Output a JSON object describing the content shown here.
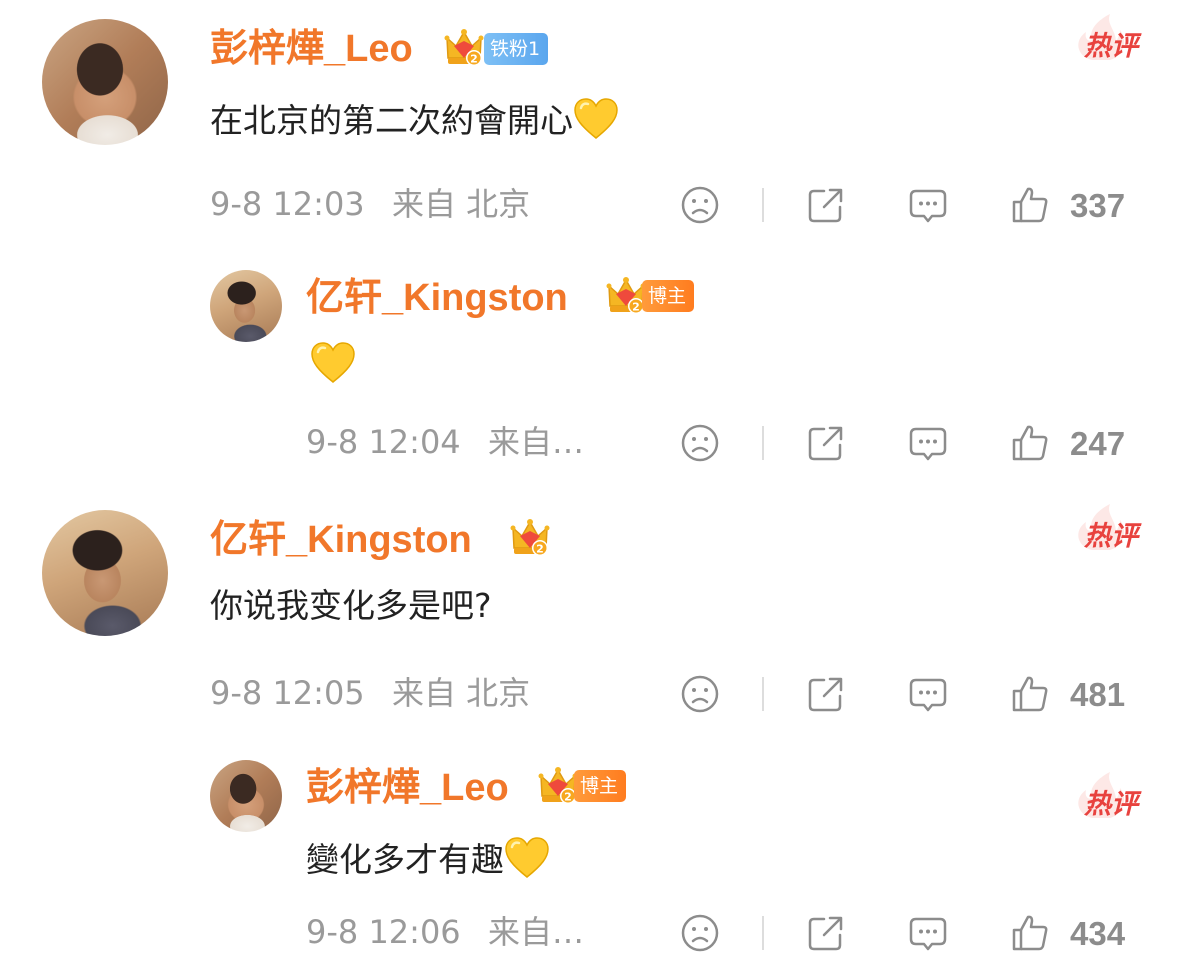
{
  "comments": [
    {
      "username": "彭梓燁_Leo",
      "badge": "铁粉1",
      "text": "在北京的第二次約會開心",
      "time": "9-8 12:03",
      "location": "来自 北京",
      "likes": "337",
      "hot_label": "热评"
    },
    {
      "username": "亿轩_Kingston",
      "badge": "博主",
      "text": "",
      "time": "9-8 12:04",
      "location": "来自…",
      "likes": "247"
    },
    {
      "username": "亿轩_Kingston",
      "text": "你说我变化多是吧?",
      "time": "9-8 12:05",
      "location": "来自 北京",
      "likes": "481",
      "hot_label": "热评"
    },
    {
      "username": "彭梓燁_Leo",
      "badge": "博主",
      "text": "變化多才有趣",
      "time": "9-8 12:06",
      "location": "来自…",
      "likes": "434",
      "hot_label": "热评"
    }
  ],
  "icons": {
    "crown": "crown-level-2-icon",
    "heart": "yellow-heart-emoji",
    "sad": "sad-face-icon",
    "share": "share-icon",
    "comment": "comment-icon",
    "like": "thumbs-up-icon"
  },
  "colors": {
    "username": "#f1772a",
    "hot": "#e8423e",
    "badge_fan": "#5aa6ee",
    "badge_host": "#ff7c1f",
    "meta": "#9a9a9a"
  }
}
